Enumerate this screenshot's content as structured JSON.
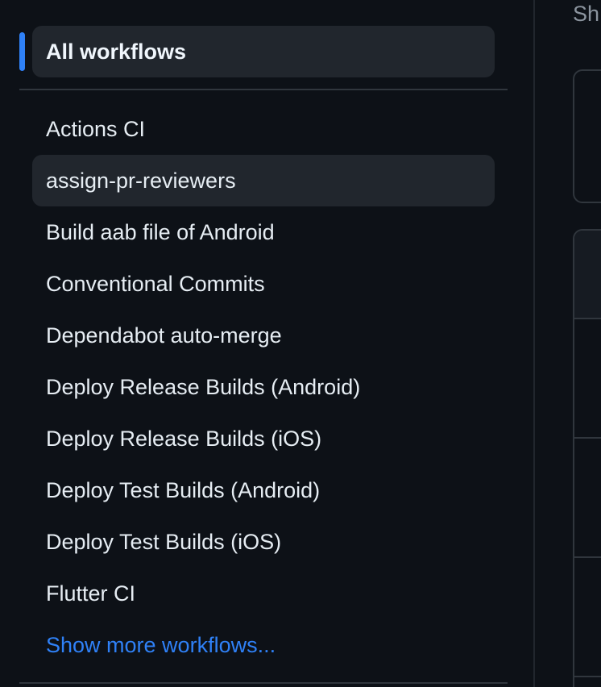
{
  "sidebar": {
    "all_workflows_label": "All workflows",
    "workflows": [
      {
        "label": "Actions CI"
      },
      {
        "label": "assign-pr-reviewers"
      },
      {
        "label": "Build aab file of Android"
      },
      {
        "label": "Conventional Commits"
      },
      {
        "label": "Dependabot auto-merge"
      },
      {
        "label": "Deploy Release Builds (Android)"
      },
      {
        "label": "Deploy Release Builds (iOS)"
      },
      {
        "label": "Deploy Test Builds (Android)"
      },
      {
        "label": "Deploy Test Builds (iOS)"
      },
      {
        "label": "Flutter CI"
      }
    ],
    "show_more_label": "Show more workflows..."
  },
  "main": {
    "partial_text": "Sh"
  },
  "colors": {
    "background": "#0d1117",
    "accent": "#2f81f7",
    "selected_bg": "#21262d",
    "border": "#30363d",
    "muted_text": "#8b949e"
  }
}
